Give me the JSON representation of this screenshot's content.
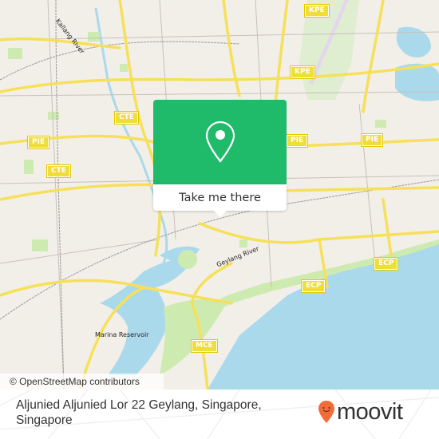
{
  "map": {
    "colors": {
      "land": "#f2efe9",
      "water": "#aad9ec",
      "park": "#cdebb0",
      "road_major": "#f6e05a",
      "road_minor": "#ffffff",
      "rail": "#999999",
      "runway": "#e3d6ee"
    },
    "road_shields": [
      {
        "id": "kpe-1",
        "label": "KPE"
      },
      {
        "id": "kpe-2",
        "label": "KPE"
      },
      {
        "id": "cte-1",
        "label": "CTE"
      },
      {
        "id": "cte-2",
        "label": "CTE"
      },
      {
        "id": "pie-1",
        "label": "PIE"
      },
      {
        "id": "pie-2",
        "label": "PIE"
      },
      {
        "id": "pie-3",
        "label": "PIE"
      },
      {
        "id": "ecp-1",
        "label": "ECP"
      },
      {
        "id": "ecp-2",
        "label": "ECP"
      },
      {
        "id": "mce-1",
        "label": "MCE"
      }
    ],
    "place_labels": {
      "kallang_river": "Kallang River",
      "geylang_river": "Geylang River",
      "marina_reservoir": "Marina Reservoir"
    },
    "attribution": "© OpenStreetMap contributors"
  },
  "popup": {
    "icon": "map-pin-icon",
    "accent": "#1fba6a",
    "cta_label": "Take me there"
  },
  "footer": {
    "address": "Aljunied Aljunied Lor 22 Geylang, Singapore, Singapore",
    "brand": {
      "name": "moovit",
      "logo_icon": "moovit-pin-icon",
      "logo_color": "#f26b3a"
    }
  }
}
